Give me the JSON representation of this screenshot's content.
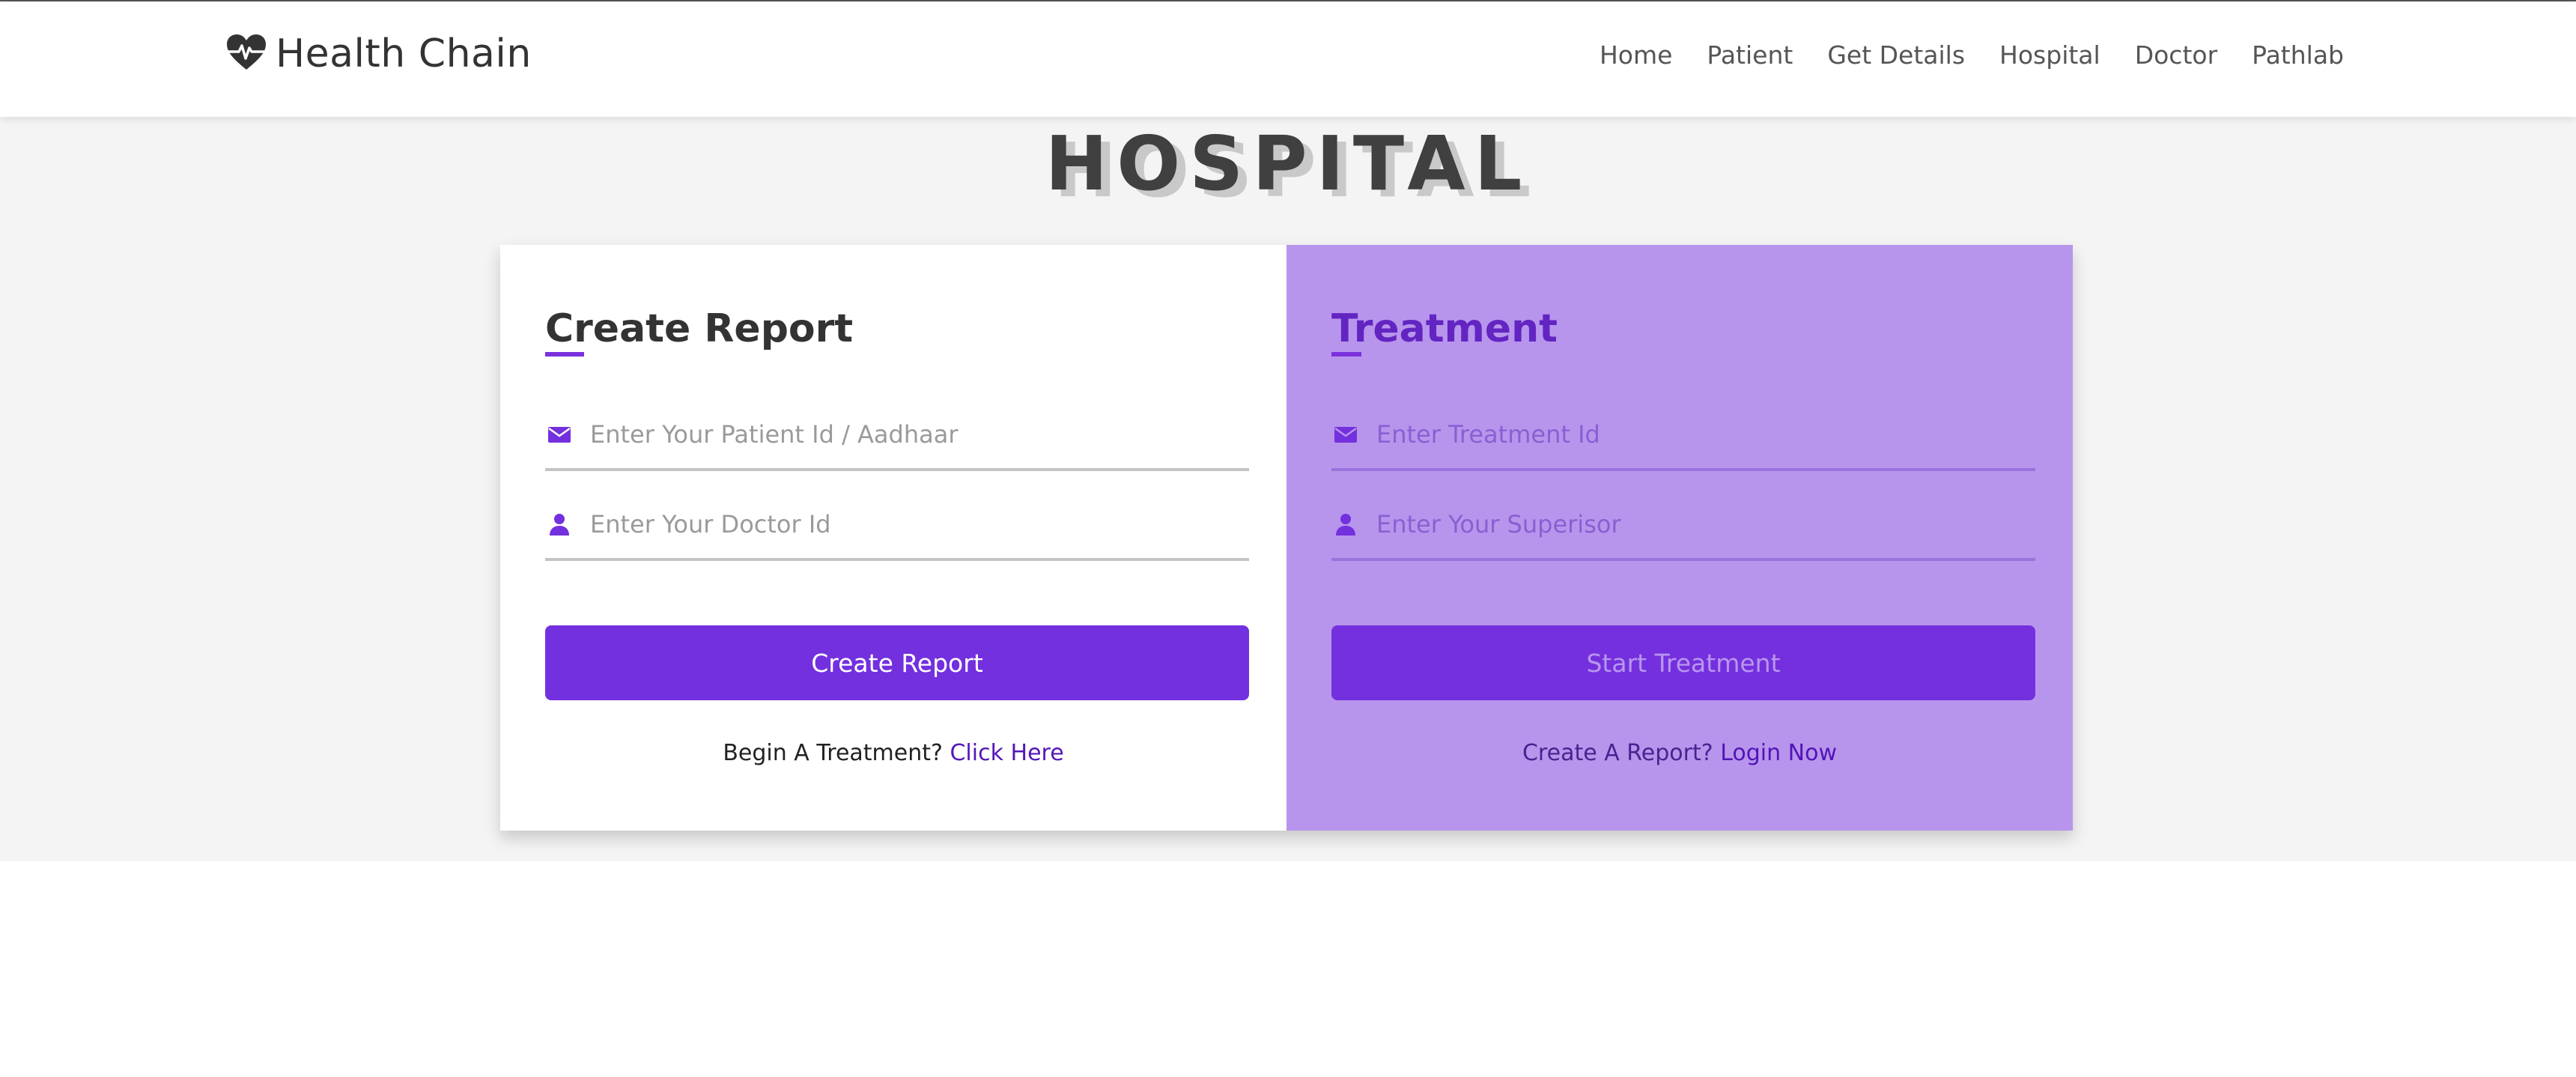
{
  "navbar": {
    "brand": "Health Chain",
    "brand_icon": "heart-pulse-icon",
    "links": [
      "Home",
      "Patient",
      "Get Details",
      "Hospital",
      "Doctor",
      "Pathlab"
    ]
  },
  "hero": {
    "title": "HOSPITAL"
  },
  "create_report": {
    "title": "Create Report",
    "patient_id": {
      "icon": "envelope-icon",
      "placeholder": "Enter Your Patient Id / Aadhaar",
      "value": ""
    },
    "doctor_id": {
      "icon": "user-icon",
      "placeholder": "Enter Your Doctor Id",
      "value": ""
    },
    "button": "Create Report",
    "switch_prompt": "Begin A Treatment?",
    "switch_link": "Click Here"
  },
  "treatment": {
    "title": "Treatment",
    "treatment_id": {
      "icon": "envelope-icon",
      "placeholder": "Enter Treatment Id",
      "value": ""
    },
    "superior": {
      "icon": "user-icon",
      "placeholder": "Enter Your Superisor",
      "value": ""
    },
    "button": "Start Treatment",
    "switch_prompt": "Create A Report?",
    "switch_link": "Login Now"
  },
  "colors": {
    "accent": "#7330de",
    "right_panel": "#b895ec",
    "hero_bg": "#f4f4f4"
  }
}
